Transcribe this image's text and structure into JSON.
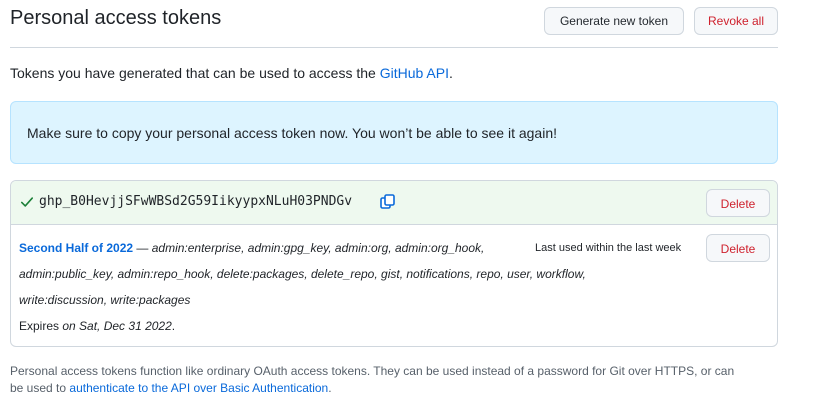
{
  "header": {
    "title": "Personal access tokens",
    "generate_label": "Generate new token",
    "revoke_label": "Revoke all"
  },
  "intro": {
    "text": "Tokens you have generated that can be used to access the ",
    "link": "GitHub API",
    "suffix": "."
  },
  "flash": {
    "text": "Make sure to copy your personal access token now. You won’t be able to see it again!"
  },
  "new_token": {
    "value": "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",
    "delete_label": "Delete"
  },
  "token": {
    "name": "Second Half of 2022",
    "separator": " — ",
    "scopes_line1": "admin:enterprise, admin:gpg_key, admin:org, admin:org_hook,",
    "scopes_line2": "admin:public_key, admin:repo_hook, delete:packages, delete_repo, gist, notifications, repo, user, workflow,",
    "scopes_line3": "write:discussion, write:packages",
    "last_used": "Last used within the last week",
    "expires_prefix": "Expires ",
    "expires_date": "on Sat, Dec 31 2022",
    "expires_suffix": ".",
    "delete_label": "Delete"
  },
  "footer": {
    "line1": "Personal access tokens function like ordinary OAuth access tokens. They can be used instead of a password for Git over HTTPS, or can",
    "line2_prefix": "be used to ",
    "line2_link": "authenticate to the API over Basic Authentication",
    "line2_suffix": "."
  },
  "colors": {
    "link": "#0969da",
    "danger": "#cf222e",
    "flash_bg": "#ddf4ff",
    "success_bg": "#eef9ef",
    "success_icon": "#1a7f37"
  },
  "icons": {
    "check": "check-icon",
    "copy": "copy-icon"
  }
}
